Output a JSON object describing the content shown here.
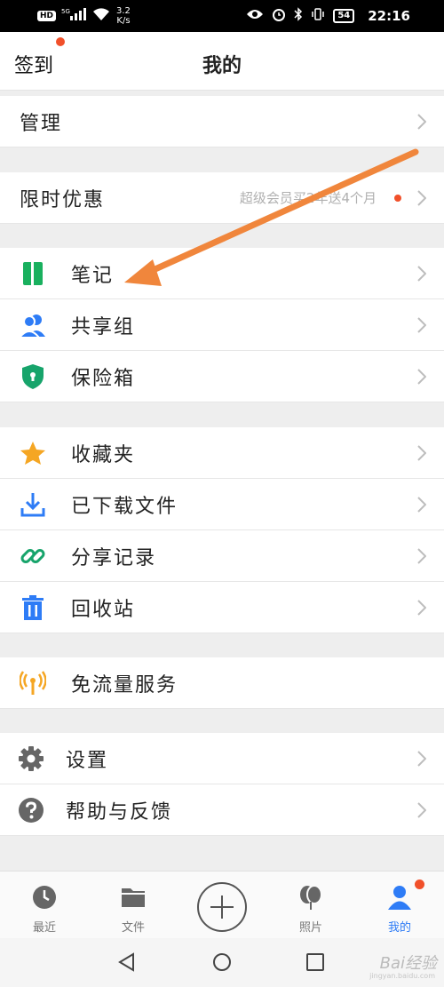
{
  "status_bar": {
    "hd": "HD",
    "signal": "5G",
    "speed_value": "3.2",
    "speed_unit": "K/s",
    "battery": "54",
    "time": "22:16"
  },
  "header": {
    "checkin_label": "签到",
    "title": "我的"
  },
  "rows": {
    "manage": "管理",
    "limited_offer": "限时优惠",
    "limited_offer_promo": "超级会员买2年送4个月",
    "notes": "笔记",
    "share_group": "共享组",
    "safe_box": "保险箱",
    "favorites": "收藏夹",
    "downloaded": "已下载文件",
    "share_records": "分享记录",
    "recycle_bin": "回收站",
    "free_traffic": "免流量服务",
    "settings": "设置",
    "help_feedback": "帮助与反馈"
  },
  "bottom_nav": {
    "recent": "最近",
    "files": "文件",
    "photos": "照片",
    "mine": "我的"
  },
  "watermark": {
    "brand": "Bai经验",
    "domain": "jingyan.baidu.com"
  },
  "colors": {
    "accent_blue": "#2e7cf6",
    "notes_green": "#19b05e",
    "safe_green": "#17a46b",
    "star_orange": "#f5a623",
    "red_dot": "#f1502a",
    "arrow_orange": "#f0863c"
  }
}
